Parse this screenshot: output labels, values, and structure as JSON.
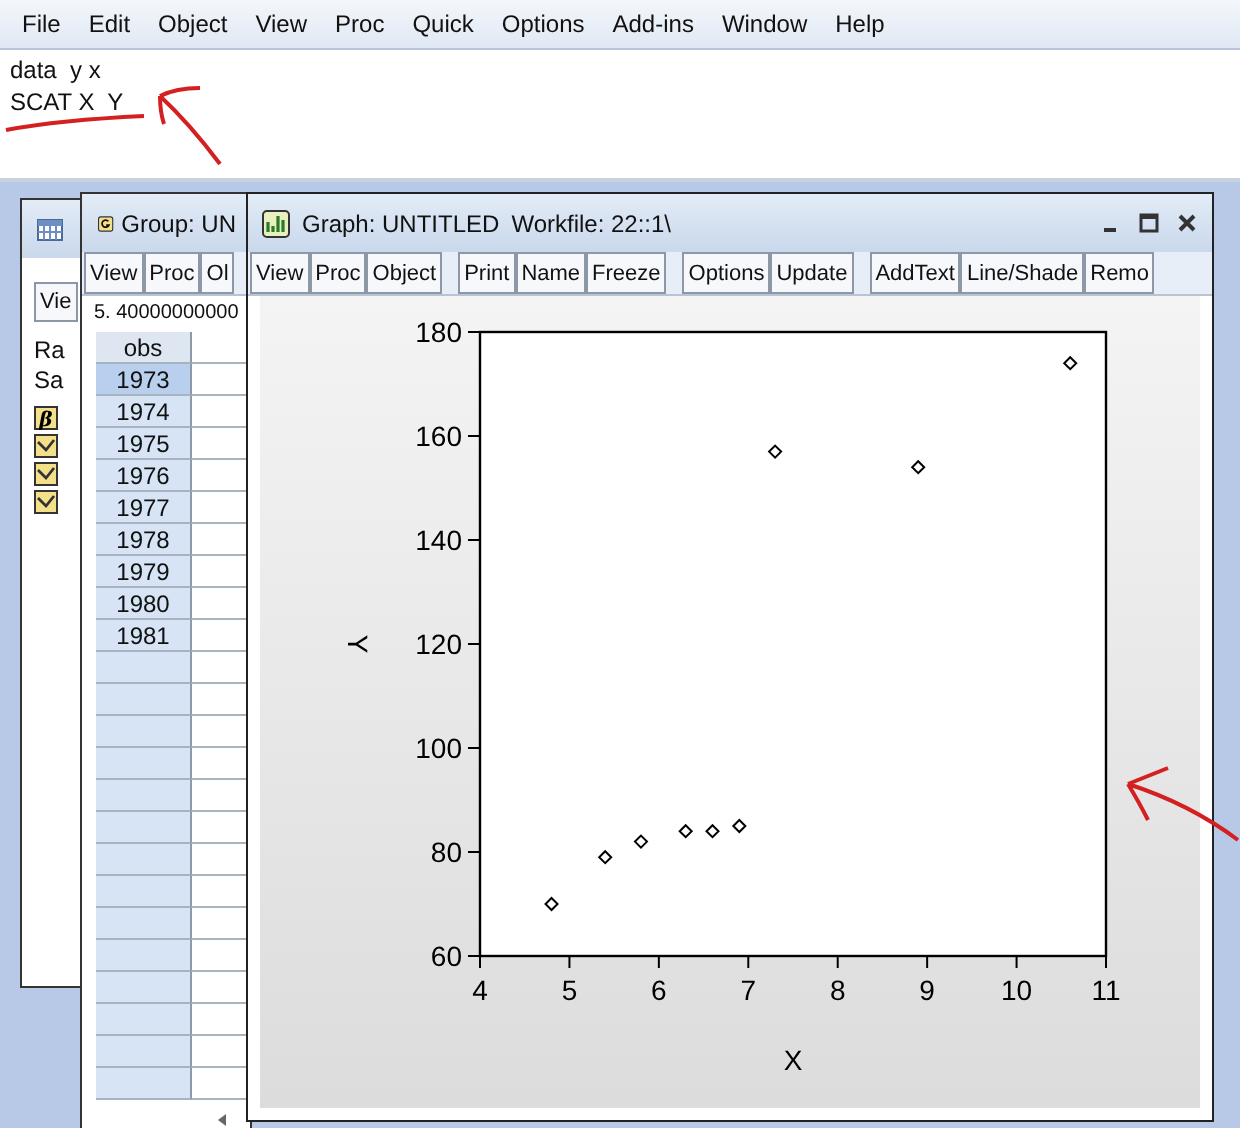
{
  "menu_bar": [
    "File",
    "Edit",
    "Object",
    "View",
    "Proc",
    "Quick",
    "Options",
    "Add-ins",
    "Window",
    "Help"
  ],
  "command_window": {
    "lines": [
      "data  y x",
      "SCAT X  Y"
    ]
  },
  "workfile_window": {
    "toolbar": [
      "Vie"
    ],
    "info_lines": [
      "Ra",
      "Sa"
    ],
    "objects": [
      {
        "kind": "coefficient",
        "symbol": "β"
      },
      {
        "kind": "series"
      },
      {
        "kind": "series"
      },
      {
        "kind": "series"
      }
    ]
  },
  "group_window": {
    "title": "Group: UN",
    "toolbar": [
      "View",
      "Proc",
      "Ol"
    ],
    "edit_line": "5. 40000000000",
    "column": "obs",
    "rows": [
      {
        "obs": "1973",
        "selected": true
      },
      {
        "obs": "1974",
        "selected": false
      },
      {
        "obs": "1975",
        "selected": false
      },
      {
        "obs": "1976",
        "selected": false
      },
      {
        "obs": "1977",
        "selected": false
      },
      {
        "obs": "1978",
        "selected": false
      },
      {
        "obs": "1979",
        "selected": false
      },
      {
        "obs": "1980",
        "selected": false
      },
      {
        "obs": "1981",
        "selected": false
      }
    ]
  },
  "graph_window": {
    "title": "Graph: UNTITLED",
    "workfile": "Workfile: 22::1\\",
    "toolbar_groups": [
      [
        "View",
        "Proc",
        "Object"
      ],
      [
        "Print",
        "Name",
        "Freeze"
      ],
      [
        "Options",
        "Update"
      ],
      [
        "AddText",
        "Line/Shade",
        "Remo"
      ]
    ],
    "chart_data": {
      "type": "scatter",
      "xlabel": "X",
      "ylabel": "Y",
      "x": [
        4.8,
        5.4,
        5.8,
        6.3,
        6.6,
        6.9,
        7.3,
        8.9,
        10.6
      ],
      "series": [
        {
          "color": "#000000",
          "values": [
            70,
            79,
            82,
            84,
            84,
            85,
            157,
            154,
            174
          ]
        }
      ],
      "xlim": [
        4,
        11
      ],
      "ylim": [
        60,
        180
      ],
      "xticks": [
        4,
        5,
        6,
        7,
        8,
        9,
        10,
        11
      ],
      "yticks": [
        60,
        80,
        100,
        120,
        140,
        160,
        180
      ]
    }
  }
}
